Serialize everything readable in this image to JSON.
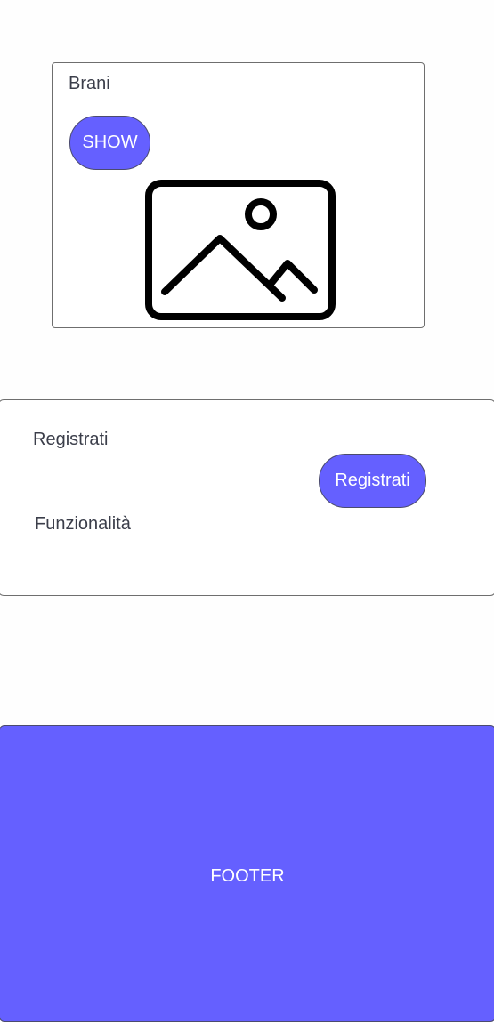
{
  "brani_card": {
    "title": "Brani",
    "show_button": "SHOW",
    "image_icon": "image-placeholder-icon"
  },
  "registrati_card": {
    "title": "Registrati",
    "button": "Registrati",
    "features_label": "Funzionalità"
  },
  "footer": {
    "label": "FOOTER"
  },
  "colors": {
    "accent": "#6560ff",
    "text": "#3b3e4a",
    "border": "#6e6e6e",
    "background": "#fefefe"
  }
}
